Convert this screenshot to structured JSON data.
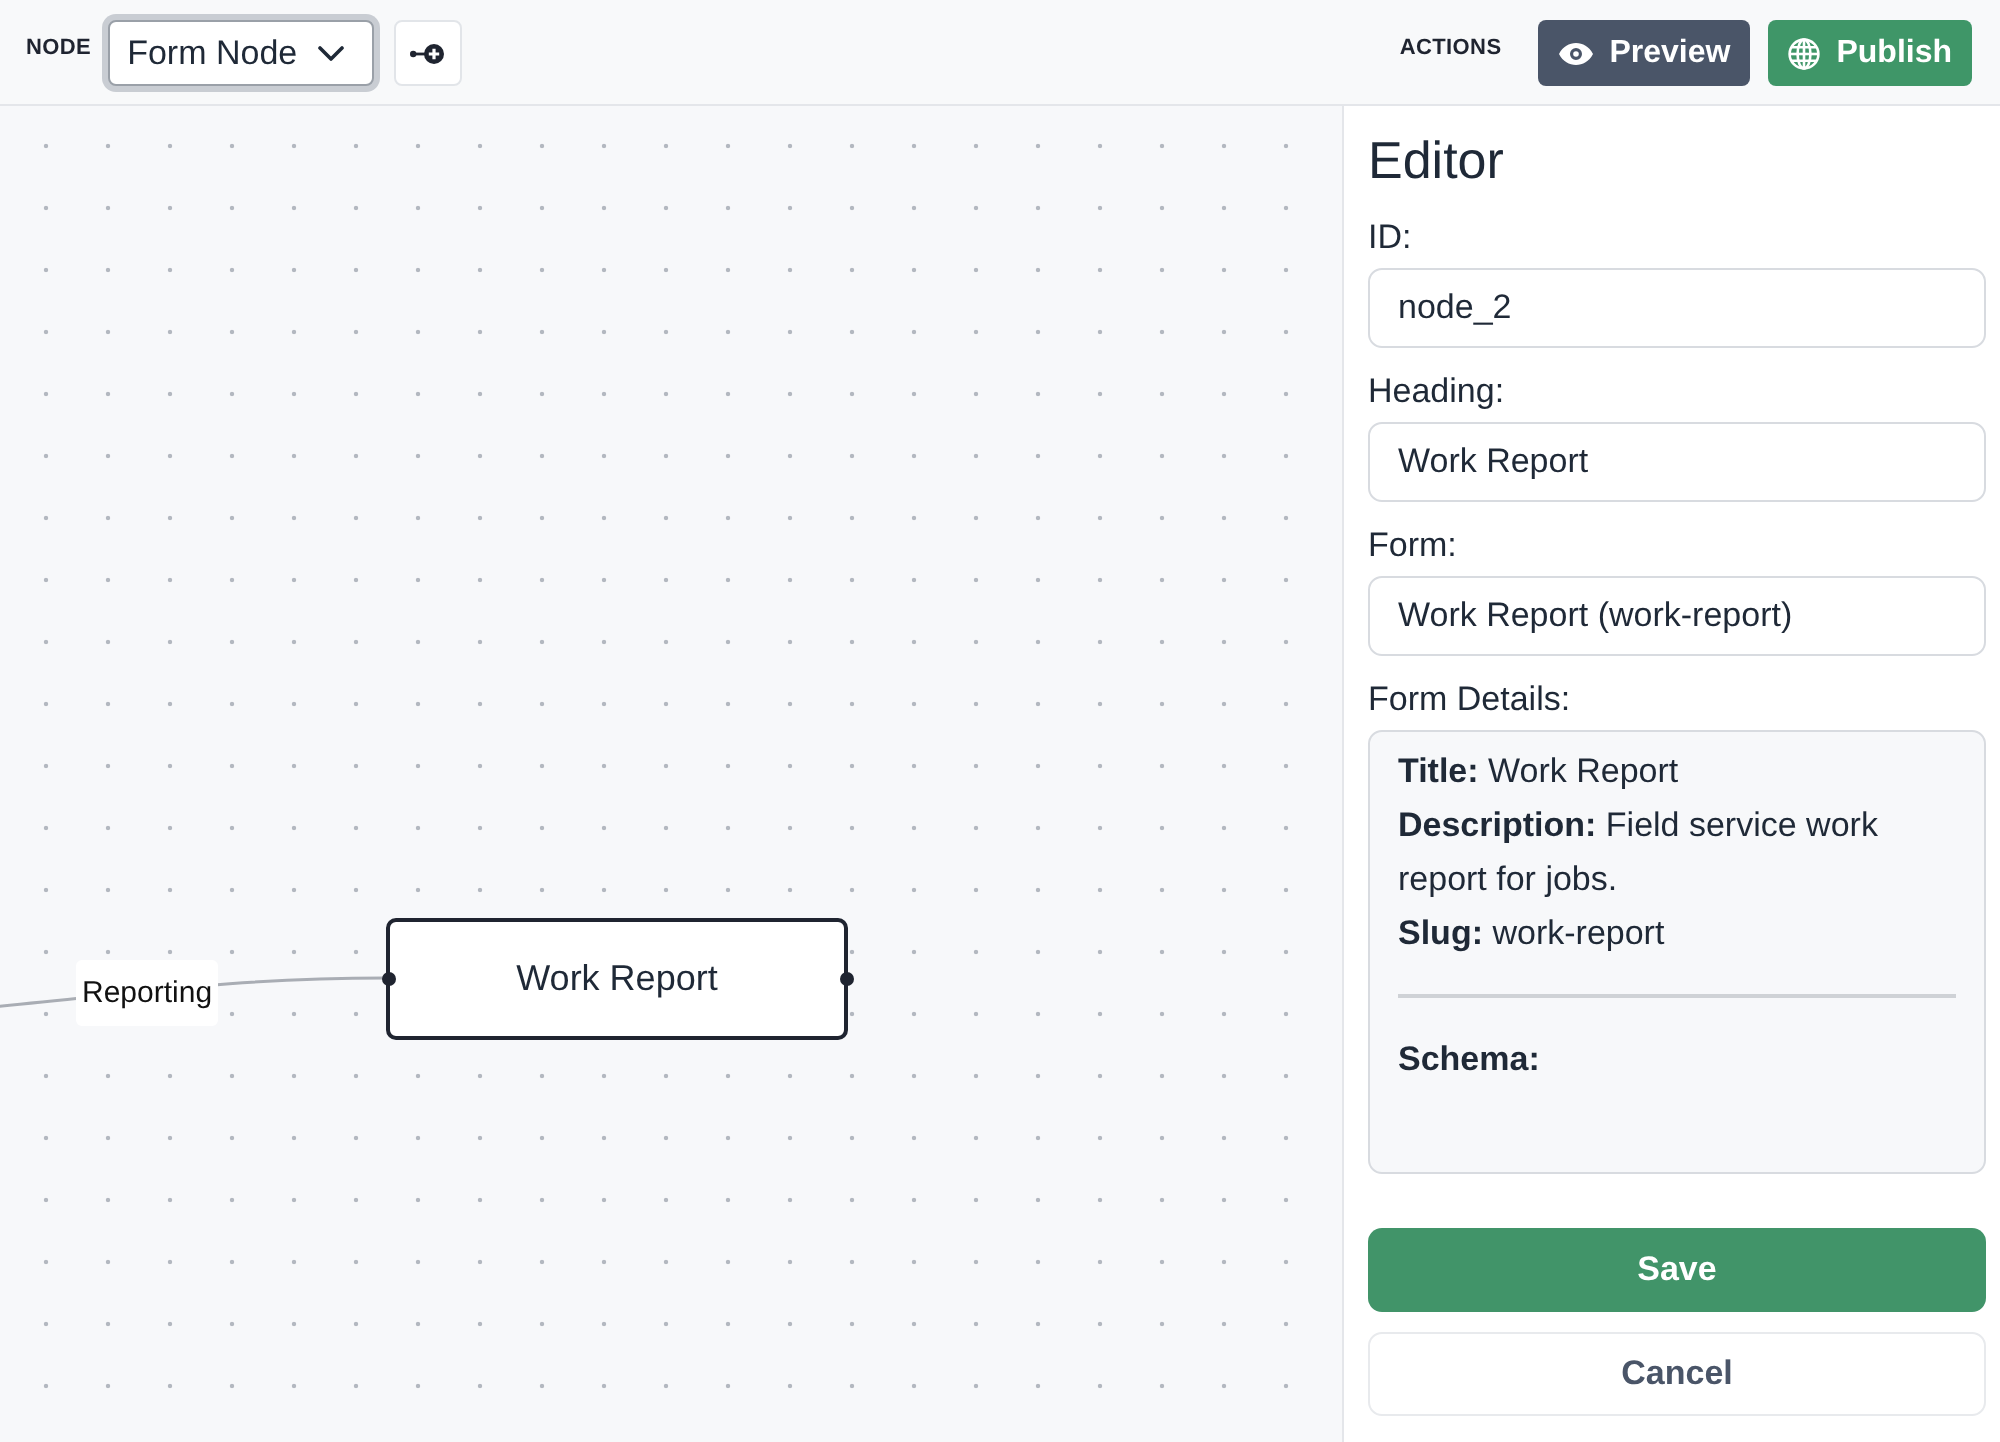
{
  "toolbar": {
    "node_label": "NODE",
    "node_type": {
      "value": "Form Node",
      "focused": true
    },
    "actions_label": "ACTIONS",
    "actions": [
      {
        "label": "Preview",
        "kind": "preview"
      },
      {
        "label": "Publish",
        "kind": "publish"
      }
    ]
  },
  "canvas": {
    "nodes": [
      {
        "label": "Work Report"
      }
    ],
    "edges": [
      {
        "label": "Reporting"
      }
    ]
  },
  "editor": {
    "title": "Editor",
    "fields": [
      {
        "label": "ID:",
        "value": "node_2"
      },
      {
        "label": "Heading:",
        "value": "Work Report"
      },
      {
        "label": "Form:",
        "value": "Work Report (work-report)"
      }
    ],
    "details": {
      "label": "Form Details:",
      "lines": [
        {
          "key": "Title:",
          "value": "Work Report"
        },
        {
          "key": "Description:",
          "value": "Field service work report for jobs."
        },
        {
          "key": "Slug:",
          "value": "work-report"
        }
      ],
      "schema_label": "Schema:"
    },
    "buttons": [
      {
        "label": "Save",
        "kind": "primary"
      },
      {
        "label": "Cancel",
        "kind": "secondary"
      }
    ]
  }
}
